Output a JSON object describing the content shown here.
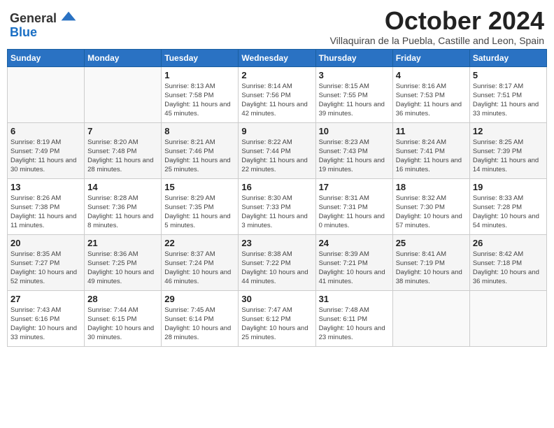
{
  "logo": {
    "general": "General",
    "blue": "Blue"
  },
  "title": {
    "month": "October 2024",
    "location": "Villaquiran de la Puebla, Castille and Leon, Spain"
  },
  "weekdays": [
    "Sunday",
    "Monday",
    "Tuesday",
    "Wednesday",
    "Thursday",
    "Friday",
    "Saturday"
  ],
  "weeks": [
    [
      {
        "day": "",
        "sunrise": "",
        "sunset": "",
        "daylight": ""
      },
      {
        "day": "",
        "sunrise": "",
        "sunset": "",
        "daylight": ""
      },
      {
        "day": "1",
        "sunrise": "Sunrise: 8:13 AM",
        "sunset": "Sunset: 7:58 PM",
        "daylight": "Daylight: 11 hours and 45 minutes."
      },
      {
        "day": "2",
        "sunrise": "Sunrise: 8:14 AM",
        "sunset": "Sunset: 7:56 PM",
        "daylight": "Daylight: 11 hours and 42 minutes."
      },
      {
        "day": "3",
        "sunrise": "Sunrise: 8:15 AM",
        "sunset": "Sunset: 7:55 PM",
        "daylight": "Daylight: 11 hours and 39 minutes."
      },
      {
        "day": "4",
        "sunrise": "Sunrise: 8:16 AM",
        "sunset": "Sunset: 7:53 PM",
        "daylight": "Daylight: 11 hours and 36 minutes."
      },
      {
        "day": "5",
        "sunrise": "Sunrise: 8:17 AM",
        "sunset": "Sunset: 7:51 PM",
        "daylight": "Daylight: 11 hours and 33 minutes."
      }
    ],
    [
      {
        "day": "6",
        "sunrise": "Sunrise: 8:19 AM",
        "sunset": "Sunset: 7:49 PM",
        "daylight": "Daylight: 11 hours and 30 minutes."
      },
      {
        "day": "7",
        "sunrise": "Sunrise: 8:20 AM",
        "sunset": "Sunset: 7:48 PM",
        "daylight": "Daylight: 11 hours and 28 minutes."
      },
      {
        "day": "8",
        "sunrise": "Sunrise: 8:21 AM",
        "sunset": "Sunset: 7:46 PM",
        "daylight": "Daylight: 11 hours and 25 minutes."
      },
      {
        "day": "9",
        "sunrise": "Sunrise: 8:22 AM",
        "sunset": "Sunset: 7:44 PM",
        "daylight": "Daylight: 11 hours and 22 minutes."
      },
      {
        "day": "10",
        "sunrise": "Sunrise: 8:23 AM",
        "sunset": "Sunset: 7:43 PM",
        "daylight": "Daylight: 11 hours and 19 minutes."
      },
      {
        "day": "11",
        "sunrise": "Sunrise: 8:24 AM",
        "sunset": "Sunset: 7:41 PM",
        "daylight": "Daylight: 11 hours and 16 minutes."
      },
      {
        "day": "12",
        "sunrise": "Sunrise: 8:25 AM",
        "sunset": "Sunset: 7:39 PM",
        "daylight": "Daylight: 11 hours and 14 minutes."
      }
    ],
    [
      {
        "day": "13",
        "sunrise": "Sunrise: 8:26 AM",
        "sunset": "Sunset: 7:38 PM",
        "daylight": "Daylight: 11 hours and 11 minutes."
      },
      {
        "day": "14",
        "sunrise": "Sunrise: 8:28 AM",
        "sunset": "Sunset: 7:36 PM",
        "daylight": "Daylight: 11 hours and 8 minutes."
      },
      {
        "day": "15",
        "sunrise": "Sunrise: 8:29 AM",
        "sunset": "Sunset: 7:35 PM",
        "daylight": "Daylight: 11 hours and 5 minutes."
      },
      {
        "day": "16",
        "sunrise": "Sunrise: 8:30 AM",
        "sunset": "Sunset: 7:33 PM",
        "daylight": "Daylight: 11 hours and 3 minutes."
      },
      {
        "day": "17",
        "sunrise": "Sunrise: 8:31 AM",
        "sunset": "Sunset: 7:31 PM",
        "daylight": "Daylight: 11 hours and 0 minutes."
      },
      {
        "day": "18",
        "sunrise": "Sunrise: 8:32 AM",
        "sunset": "Sunset: 7:30 PM",
        "daylight": "Daylight: 10 hours and 57 minutes."
      },
      {
        "day": "19",
        "sunrise": "Sunrise: 8:33 AM",
        "sunset": "Sunset: 7:28 PM",
        "daylight": "Daylight: 10 hours and 54 minutes."
      }
    ],
    [
      {
        "day": "20",
        "sunrise": "Sunrise: 8:35 AM",
        "sunset": "Sunset: 7:27 PM",
        "daylight": "Daylight: 10 hours and 52 minutes."
      },
      {
        "day": "21",
        "sunrise": "Sunrise: 8:36 AM",
        "sunset": "Sunset: 7:25 PM",
        "daylight": "Daylight: 10 hours and 49 minutes."
      },
      {
        "day": "22",
        "sunrise": "Sunrise: 8:37 AM",
        "sunset": "Sunset: 7:24 PM",
        "daylight": "Daylight: 10 hours and 46 minutes."
      },
      {
        "day": "23",
        "sunrise": "Sunrise: 8:38 AM",
        "sunset": "Sunset: 7:22 PM",
        "daylight": "Daylight: 10 hours and 44 minutes."
      },
      {
        "day": "24",
        "sunrise": "Sunrise: 8:39 AM",
        "sunset": "Sunset: 7:21 PM",
        "daylight": "Daylight: 10 hours and 41 minutes."
      },
      {
        "day": "25",
        "sunrise": "Sunrise: 8:41 AM",
        "sunset": "Sunset: 7:19 PM",
        "daylight": "Daylight: 10 hours and 38 minutes."
      },
      {
        "day": "26",
        "sunrise": "Sunrise: 8:42 AM",
        "sunset": "Sunset: 7:18 PM",
        "daylight": "Daylight: 10 hours and 36 minutes."
      }
    ],
    [
      {
        "day": "27",
        "sunrise": "Sunrise: 7:43 AM",
        "sunset": "Sunset: 6:16 PM",
        "daylight": "Daylight: 10 hours and 33 minutes."
      },
      {
        "day": "28",
        "sunrise": "Sunrise: 7:44 AM",
        "sunset": "Sunset: 6:15 PM",
        "daylight": "Daylight: 10 hours and 30 minutes."
      },
      {
        "day": "29",
        "sunrise": "Sunrise: 7:45 AM",
        "sunset": "Sunset: 6:14 PM",
        "daylight": "Daylight: 10 hours and 28 minutes."
      },
      {
        "day": "30",
        "sunrise": "Sunrise: 7:47 AM",
        "sunset": "Sunset: 6:12 PM",
        "daylight": "Daylight: 10 hours and 25 minutes."
      },
      {
        "day": "31",
        "sunrise": "Sunrise: 7:48 AM",
        "sunset": "Sunset: 6:11 PM",
        "daylight": "Daylight: 10 hours and 23 minutes."
      },
      {
        "day": "",
        "sunrise": "",
        "sunset": "",
        "daylight": ""
      },
      {
        "day": "",
        "sunrise": "",
        "sunset": "",
        "daylight": ""
      }
    ]
  ]
}
